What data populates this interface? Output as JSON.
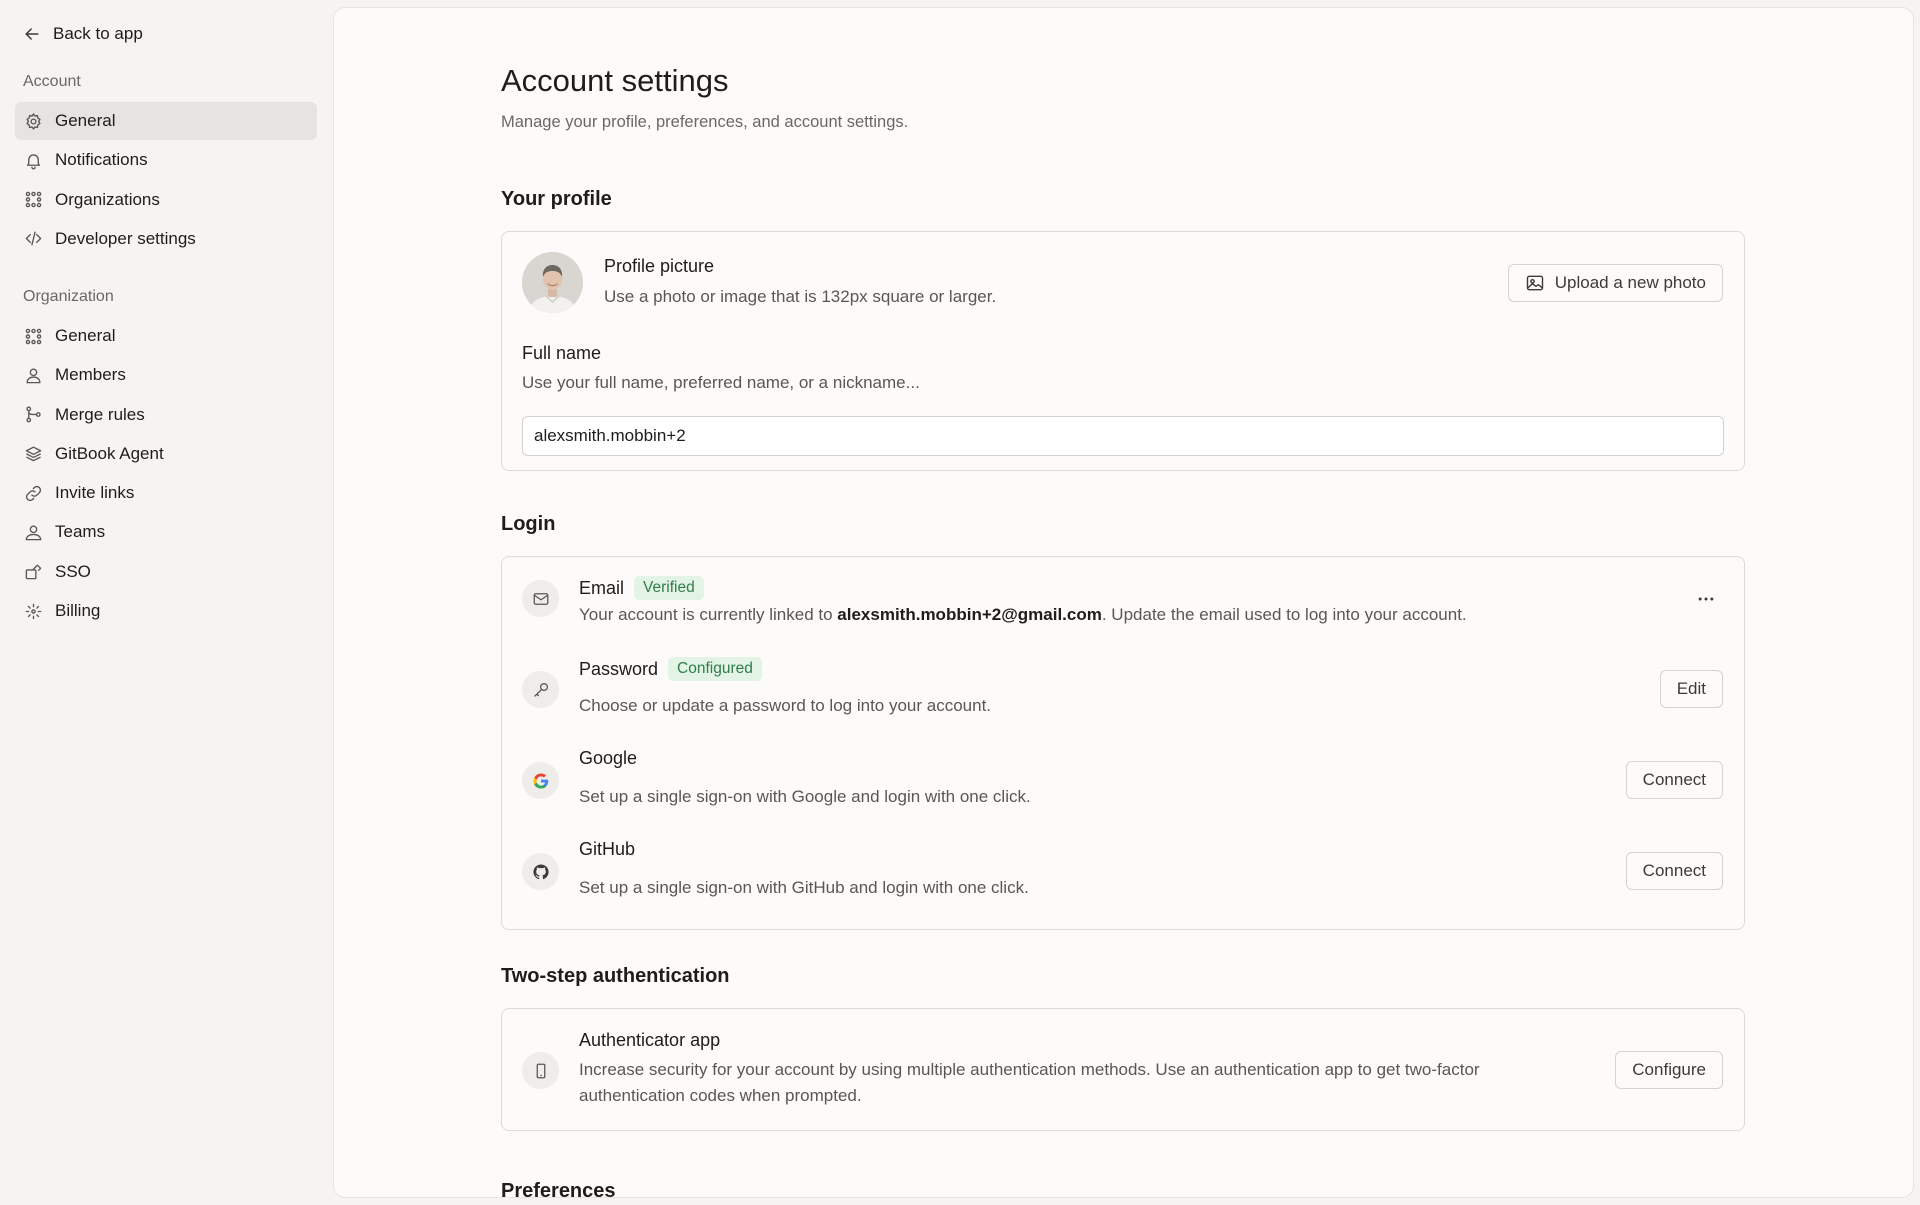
{
  "sidebar": {
    "back_label": "Back to app",
    "account_heading": "Account",
    "account_items": [
      {
        "label": "General",
        "icon": "gear-icon"
      },
      {
        "label": "Notifications",
        "icon": "bell-icon"
      },
      {
        "label": "Organizations",
        "icon": "organizations-icon"
      },
      {
        "label": "Developer settings",
        "icon": "code-icon"
      }
    ],
    "organization_heading": "Organization",
    "organization_items": [
      {
        "label": "General",
        "icon": "organization-general-icon"
      },
      {
        "label": "Members",
        "icon": "user-icon"
      },
      {
        "label": "Merge rules",
        "icon": "merge-icon"
      },
      {
        "label": "GitBook Agent",
        "icon": "agent-icon"
      },
      {
        "label": "Invite links",
        "icon": "link-icon"
      },
      {
        "label": "Teams",
        "icon": "team-icon"
      },
      {
        "label": "SSO",
        "icon": "sso-icon"
      },
      {
        "label": "Billing",
        "icon": "billing-icon"
      }
    ]
  },
  "main": {
    "title": "Account settings",
    "subtitle": "Manage your profile, preferences, and account settings.",
    "profile": {
      "section_title": "Your profile",
      "picture_title": "Profile picture",
      "picture_desc": "Use a photo or image that is 132px square or larger.",
      "upload_label": "Upload a new photo",
      "full_name_label": "Full name",
      "full_name_desc": "Use your full name, preferred name, or a nickname...",
      "full_name_value": "alexsmith.mobbin+2"
    },
    "login": {
      "section_title": "Login",
      "email": {
        "title": "Email",
        "badge": "Verified",
        "desc_prefix": "Your account is currently linked to ",
        "desc_email": "alexsmith.mobbin+2@gmail.com",
        "desc_suffix": ". Update the email used to log into your account."
      },
      "password": {
        "title": "Password",
        "badge": "Configured",
        "desc": "Choose or update a password to log into your account.",
        "button": "Edit"
      },
      "google": {
        "title": "Google",
        "desc": "Set up a single sign-on with Google and login with one click.",
        "button": "Connect"
      },
      "github": {
        "title": "GitHub",
        "desc": "Set up a single sign-on with GitHub and login with one click.",
        "button": "Connect"
      }
    },
    "two_step": {
      "section_title": "Two-step authentication",
      "app_title": "Authenticator app",
      "app_desc_line1": "Increase security for your account by using multiple authentication methods. Use an authentication app to get two-factor",
      "app_desc_line2": "authentication codes when prompted.",
      "button": "Configure"
    },
    "preferences_title": "Preferences"
  },
  "colors": {
    "badge_bg": "#e3f4e7",
    "badge_text": "#2f7d47",
    "active_nav_bg": "#e6e4e0"
  }
}
